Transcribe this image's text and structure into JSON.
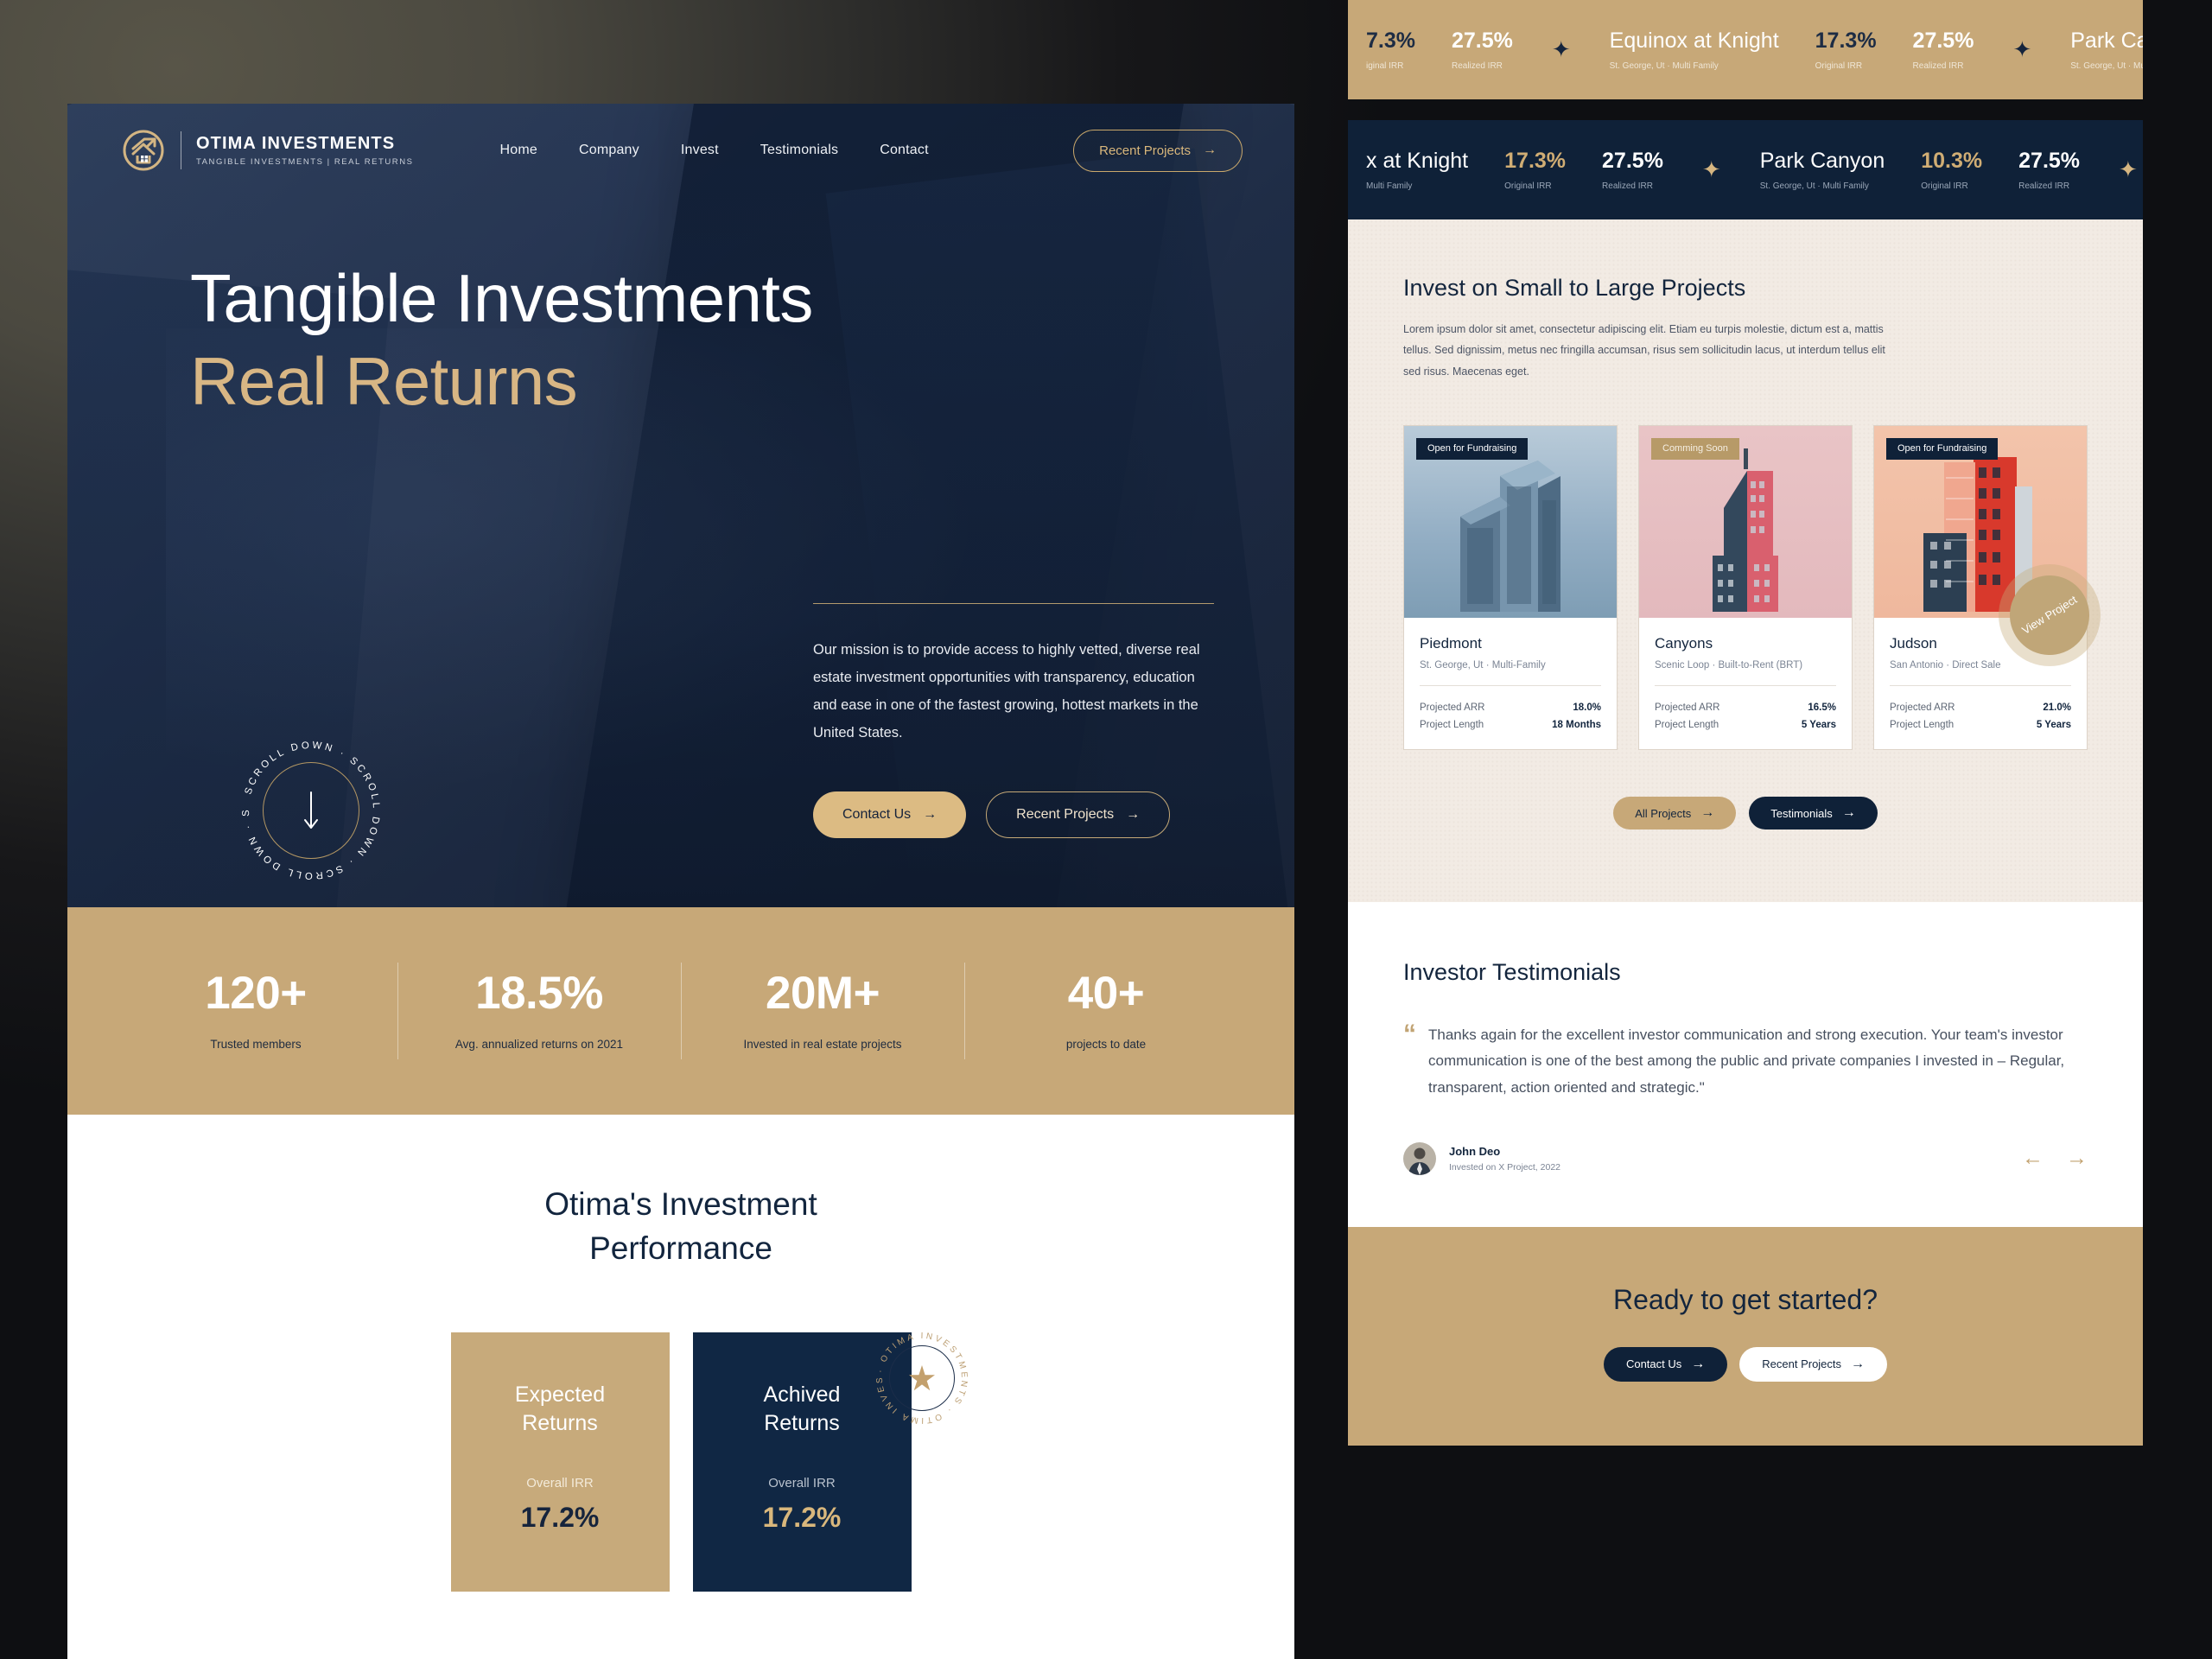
{
  "brand": {
    "name": "OTIMA INVESTMENTS",
    "tagline": "TANGIBLE INVESTMENTS | REAL RETURNS",
    "logo_icon": "house-arrow-circle-icon"
  },
  "nav": {
    "links": [
      "Home",
      "Company",
      "Invest",
      "Testimonials",
      "Contact"
    ],
    "cta": "Recent Projects"
  },
  "hero": {
    "title_line1": "Tangible Investments",
    "title_line2": "Real Returns",
    "mission": "Our mission is to provide access to highly vetted, diverse real estate investment opportunities with transparency, education and ease in one of the fastest growing, hottest markets in the United States.",
    "btn_primary": "Contact Us",
    "btn_secondary": "Recent Projects",
    "scroll_text": "SCROLL DOWN · SCROLL DOWN · ",
    "scroll_icon": "arrow-down-icon"
  },
  "stats": [
    {
      "value": "120+",
      "label": "Trusted members"
    },
    {
      "value": "18.5%",
      "label": "Avg. annualized returns on 2021"
    },
    {
      "value": "20M+",
      "label": "Invested in real estate projects"
    },
    {
      "value": "40+",
      "label": "projects to date"
    }
  ],
  "performance": {
    "heading_line1": "Otima's Investment",
    "heading_line2": "Performance",
    "seal_text": "· OTIMA INVESTMENTS ",
    "seal_icon": "star-icon",
    "cards": [
      {
        "title_line1": "Expected",
        "title_line2": "Returns",
        "metric_label": "Overall IRR",
        "metric_value": "17.2%"
      },
      {
        "title_line1": "Achived",
        "title_line2": "Returns",
        "metric_label": "Overall IRR",
        "metric_value": "17.2%"
      }
    ]
  },
  "ticker_gold": [
    {
      "original_irr": "7.3%",
      "original_label": "iginal IRR",
      "realized_irr": "27.5%",
      "realized_label": "Realized IRR"
    },
    {
      "name": "Equinox at Knight",
      "location": "St. George, Ut · Multi Family",
      "original_irr": "17.3%",
      "original_label": "Original IRR",
      "realized_irr": "27.5%",
      "realized_label": "Realized IRR"
    },
    {
      "name": "Park Canyo",
      "location": "St. George, Ut · Multi Family"
    }
  ],
  "ticker_navy": [
    {
      "name": "x at Knight",
      "location": "Multi Family",
      "original_irr": "17.3%",
      "original_label": "Original IRR",
      "realized_irr": "27.5%",
      "realized_label": "Realized IRR"
    },
    {
      "name": "Park Canyon",
      "location": "St. George, Ut · Multi Family",
      "original_irr": "10.3%",
      "original_label": "Original IRR",
      "realized_irr": "27.5%",
      "realized_label": "Realized IRR"
    }
  ],
  "projects": {
    "heading": "Invest on Small to Large Projects",
    "paragraph": "Lorem ipsum dolor sit amet, consectetur adipiscing elit. Etiam eu turpis molestie, dictum est a, mattis tellus. Sed dignissim, metus nec fringilla accumsan, risus sem sollicitudin lacus, ut interdum tellus elit sed risus. Maecenas eget.",
    "view_project_label": "View Project",
    "cards": [
      {
        "badge": "Open for Fundraising",
        "badge_style": "navy",
        "title": "Piedmont",
        "subtitle": "St. George, Ut  ·  Multi-Family",
        "stats": [
          {
            "key": "Projected ARR",
            "value": "18.0%"
          },
          {
            "key": "Project Length",
            "value": "18 Months"
          }
        ]
      },
      {
        "badge": "Comming Soon",
        "badge_style": "gold",
        "title": "Canyons",
        "subtitle": "Scenic Loop  ·  Built-to-Rent (BRT)",
        "stats": [
          {
            "key": "Projected ARR",
            "value": "16.5%"
          },
          {
            "key": "Project Length",
            "value": "5 Years"
          }
        ]
      },
      {
        "badge": "Open for Fundraising",
        "badge_style": "navy",
        "title": "Judson",
        "subtitle": "San Antonio  ·  Direct Sale",
        "stats": [
          {
            "key": "Projected ARR",
            "value": "21.0%"
          },
          {
            "key": "Project Length",
            "value": "5 Years"
          }
        ]
      }
    ],
    "btn_all": "All Projects",
    "btn_testimonials": "Testimonials"
  },
  "testimonials": {
    "heading": "Investor Testimonials",
    "quote": "Thanks again for the excellent investor communication and strong execution. Your team's investor communication is one of the best among the public and private companies I invested in – Regular, transparent, action oriented and strategic.\"",
    "author": "John Deo",
    "author_meta": "Invested on X Project, 2022",
    "prev_icon": "arrow-left-icon",
    "next_icon": "arrow-right-icon"
  },
  "cta": {
    "heading": "Ready to get started?",
    "btn_primary": "Contact Us",
    "btn_secondary": "Recent Projects"
  },
  "colors": {
    "navy": "#0f2138",
    "gold": "#c7a878",
    "gold_light": "#d9b77c",
    "cream": "#f2ebe4"
  }
}
